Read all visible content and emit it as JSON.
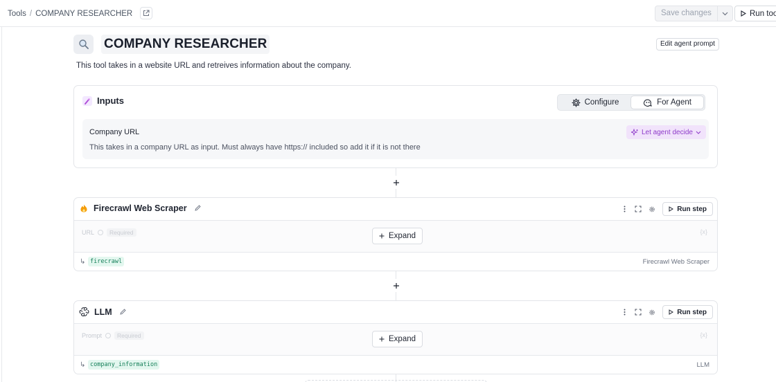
{
  "breadcrumb": {
    "root": "Tools",
    "separator": "/",
    "current": "COMPANY RESEARCHER"
  },
  "header_actions": {
    "save_label": "Save changes",
    "run_tool_label": "Run tool"
  },
  "tool": {
    "icon": "search-icon",
    "title": "COMPANY RESEARCHER",
    "description": "This tool takes in a website URL and retreives information about the company.",
    "edit_prompt_label": "Edit agent prompt"
  },
  "inputs": {
    "heading": "Inputs",
    "segments": [
      {
        "label": "Configure",
        "icon": "gear-icon",
        "active": false
      },
      {
        "label": "For Agent",
        "icon": "agent-icon",
        "active": true
      }
    ],
    "field": {
      "name": "Company URL",
      "description": "This takes in a company URL as input. Must always have https:// included so add it if it is not there",
      "agent_pill": "Let agent decide"
    }
  },
  "steps": [
    {
      "title": "Firecrawl Web Scraper",
      "icon": "firecrawl-icon",
      "run_label": "Run step",
      "ghost_field": "URL",
      "ghost_required": "Required",
      "ghost_right": "{x}",
      "expand_label": "Expand",
      "output_var": "firecrawl",
      "output_source": "Firecrawl Web Scraper"
    },
    {
      "title": "LLM",
      "icon": "openai-icon",
      "run_label": "Run step",
      "ghost_field": "Prompt",
      "ghost_required": "Required",
      "ghost_right": "{x}",
      "expand_label": "Expand",
      "output_var": "company_information",
      "output_source": "LLM"
    }
  ],
  "colors": {
    "accent_purple": "#8e3bc9",
    "output_green": "#17805a",
    "border": "#e3e5e9"
  }
}
